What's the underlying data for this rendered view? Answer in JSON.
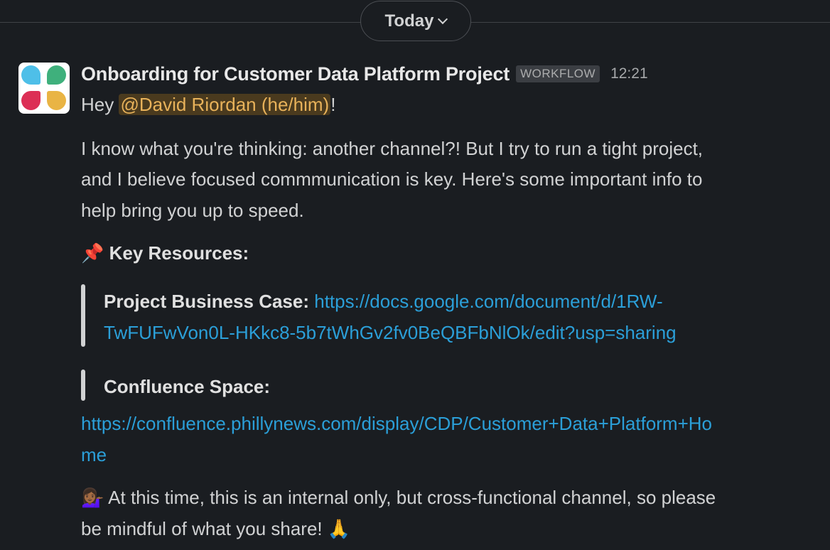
{
  "divider": {
    "date_label": "Today",
    "chevron": "chevron-down-icon"
  },
  "message": {
    "avatar": "workflow-avatar-icon",
    "sender": "Onboarding for Customer Data Platform Project",
    "badge": "WORKFLOW",
    "time": "12:21",
    "greeting_prefix": "Hey ",
    "mention": "@David Riordan (he/him)",
    "greeting_suffix": "!",
    "paragraph_lines": [
      "I know what you're thinking: another channel?! But I try to run a tight project,",
      "and I believe focused commmunication is key. Here's some important info to",
      "help bring you up to speed."
    ],
    "key_resources_emoji": "📌",
    "key_resources_heading": "Key Resources:",
    "business_case_label": "Project Business Case:",
    "business_case_link_line1": "https://docs.google.com/document/d/1RW-",
    "business_case_link_line2": "TwFUFwVon0L-HKkc8-5b7tWhGv2fv0BeQBFbNlOk/edit?usp=sharing",
    "confluence_label": "Confluence Space:",
    "confluence_link_line1": "https://confluence.phillynews.com/display/CDP/Customer+Data+Platform+Ho",
    "confluence_link_line2": "me",
    "notice_emoji": "💁🏾‍♀️",
    "notice_line1": "At this time, this is an internal only, but cross-functional channel, so please",
    "notice_line2": "be mindful of what you share! ",
    "notice_end_emoji": "🙏"
  },
  "colors": {
    "background": "#1a1d21",
    "text": "#d1d2d3",
    "link": "#2b9fd8",
    "mention_bg": "#4a3a1e",
    "mention_text": "#e8b25a"
  }
}
